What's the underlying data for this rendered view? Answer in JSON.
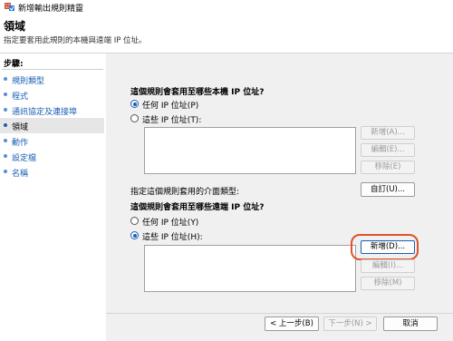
{
  "window": {
    "title": "新增輸出規則精靈"
  },
  "header": {
    "title": "領域",
    "subtitle": "指定要套用此規則的本機與遠端 IP 位址。"
  },
  "sidebar": {
    "steps_label": "步驟:",
    "items": [
      {
        "label": "規則類型"
      },
      {
        "label": "程式"
      },
      {
        "label": "通訊協定及連接埠"
      },
      {
        "label": "領域"
      },
      {
        "label": "動作"
      },
      {
        "label": "設定檔"
      },
      {
        "label": "名稱"
      }
    ]
  },
  "local": {
    "question": "這個規則會套用至哪些本機 IP 位址?",
    "any_label": "任何 IP 位址(P)",
    "these_label": "這些 IP 位址(T):",
    "add": "新增(A)...",
    "edit": "編輯(E)...",
    "remove": "移除(E)"
  },
  "interface": {
    "label": "指定這個規則套用的介面類型:",
    "customize": "自訂(U)..."
  },
  "remote": {
    "question": "這個規則會套用至哪些遠端 IP 位址?",
    "any_label": "任何 IP 位址(Y)",
    "these_label": "這些 IP 位址(H):",
    "add": "新增(D)...",
    "edit": "編輯(I)...",
    "remove": "移除(M)"
  },
  "footer": {
    "back": "< 上一步(B)",
    "next": "下一步(N) >",
    "cancel": "取消"
  }
}
